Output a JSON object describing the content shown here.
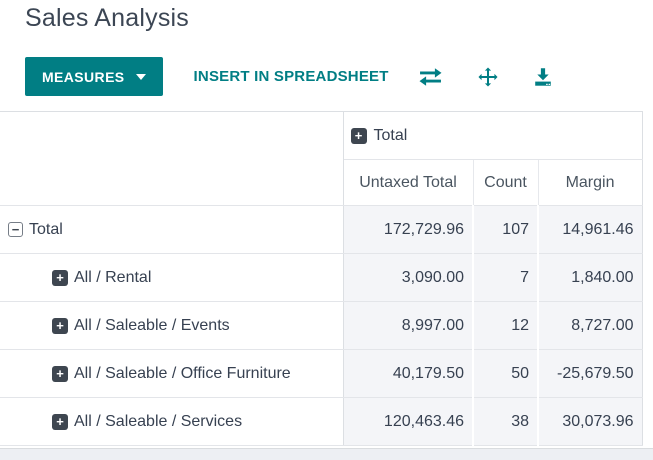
{
  "page_title": "Sales Analysis",
  "toolbar": {
    "measures_label": "MEASURES",
    "insert_in_spreadsheet_label": "INSERT IN SPREADSHEET",
    "icons": [
      "flip-axis-icon",
      "expand-all-icon",
      "download-icon"
    ]
  },
  "colors": {
    "accent_teal": "#017e84",
    "text_dark": "#374151",
    "cell_background": "#f4f5f8",
    "row_border": "#e3e5e9",
    "icon_square_dark": "#3e4650"
  },
  "pivot": {
    "column_group": {
      "label": "Total",
      "state": "collapsed"
    },
    "measure_headers": [
      "Untaxed Total",
      "Count",
      "Margin"
    ],
    "rows": [
      {
        "label": "Total",
        "depth": 0,
        "state": "expanded",
        "values": [
          "172,729.96",
          "107",
          "14,961.46"
        ]
      },
      {
        "label": "All / Rental",
        "depth": 1,
        "state": "collapsed",
        "values": [
          "3,090.00",
          "7",
          "1,840.00"
        ]
      },
      {
        "label": "All / Saleable / Events",
        "depth": 1,
        "state": "collapsed",
        "values": [
          "8,997.00",
          "12",
          "8,727.00"
        ]
      },
      {
        "label": "All / Saleable / Office Furniture",
        "depth": 1,
        "state": "collapsed",
        "values": [
          "40,179.50",
          "50",
          "-25,679.50"
        ]
      },
      {
        "label": "All / Saleable / Services",
        "depth": 1,
        "state": "collapsed",
        "values": [
          "120,463.46",
          "38",
          "30,073.96"
        ]
      }
    ]
  },
  "chart_data": {
    "type": "table",
    "title": "Sales Analysis",
    "columns": [
      "Untaxed Total",
      "Count",
      "Margin"
    ],
    "rows": [
      {
        "group": "Total",
        "untaxed_total": 172729.96,
        "count": 107,
        "margin": 14961.46
      },
      {
        "group": "All / Rental",
        "untaxed_total": 3090.0,
        "count": 7,
        "margin": 1840.0
      },
      {
        "group": "All / Saleable / Events",
        "untaxed_total": 8997.0,
        "count": 12,
        "margin": 8727.0
      },
      {
        "group": "All / Saleable / Office Furniture",
        "untaxed_total": 40179.5,
        "count": 50,
        "margin": -25679.5
      },
      {
        "group": "All / Saleable / Services",
        "untaxed_total": 120463.46,
        "count": 38,
        "margin": 30073.96
      }
    ]
  }
}
